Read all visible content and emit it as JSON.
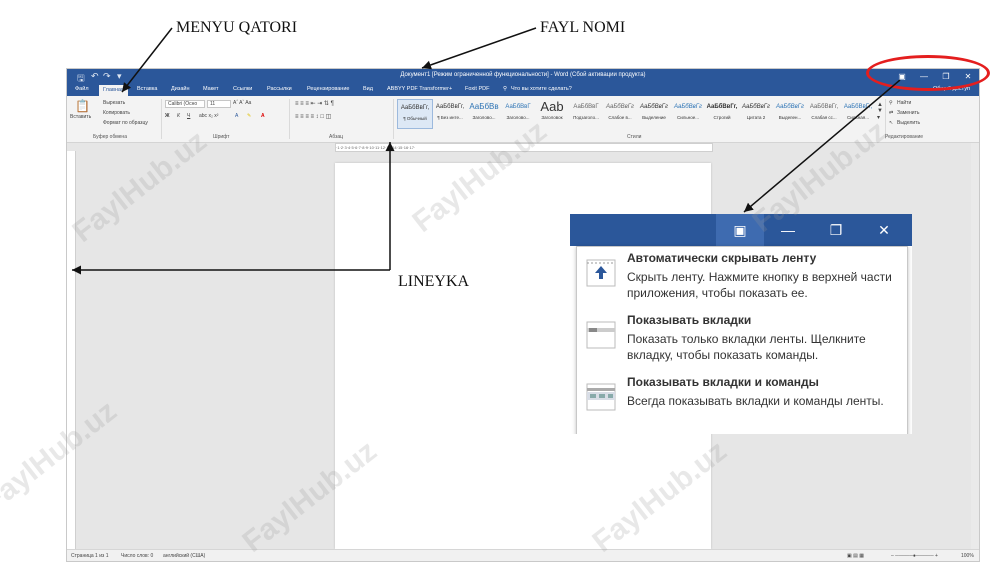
{
  "annotations": {
    "menu_row": "MENYU QATORI",
    "file_name": "FAYL NOMI",
    "ruler": "LINEYKA"
  },
  "watermark": "FaylHub.uz",
  "window": {
    "title": "Документ1 [Режим ограниченной функциональности] - Word (Сбой активации продукта)",
    "share_label": "Общий доступ",
    "tabs": [
      "Файл",
      "Главная",
      "Вставка",
      "Дизайн",
      "Макет",
      "Ссылки",
      "Рассылки",
      "Рецензирование",
      "Вид",
      "ABBYY PDF Transformer+",
      "Foxit PDF"
    ],
    "tell_me": "Что вы хотите сделать?"
  },
  "ribbon": {
    "clipboard": {
      "paste": "Вставить",
      "cut": "Вырезать",
      "copy": "Копировать",
      "format_painter": "Формат по образцу",
      "group": "Буфер обмена"
    },
    "font": {
      "name": "Calibri (Осно",
      "size": "11",
      "group": "Шрифт"
    },
    "paragraph": {
      "group": "Абзац"
    },
    "styles": {
      "group": "Стили",
      "items": [
        {
          "sample": "АаБбВвГг,",
          "name": "¶ Обычный"
        },
        {
          "sample": "АаБбВвГг,",
          "name": "¶ Без инте..."
        },
        {
          "sample": "АаБбВв",
          "name": "Заголово..."
        },
        {
          "sample": "АаБбВвГ",
          "name": "Заголово..."
        },
        {
          "sample": "Aab",
          "name": "Заголовок"
        },
        {
          "sample": "АаБбВвГ",
          "name": "Подзаголо..."
        },
        {
          "sample": "АаБбВвГг",
          "name": "Слабое в..."
        },
        {
          "sample": "АаБбВвГг",
          "name": "Выделение"
        },
        {
          "sample": "АаБбВвГг",
          "name": "Сильное..."
        },
        {
          "sample": "АаБбВвГг,",
          "name": "Строгий"
        },
        {
          "sample": "АаБбВвГг",
          "name": "Цитата 2"
        },
        {
          "sample": "АаБбВвГг",
          "name": "Выделен..."
        },
        {
          "sample": "АаБбВвГг,",
          "name": "Слабая сс..."
        },
        {
          "sample": "АаБбВвГг,",
          "name": "Сильная..."
        }
      ]
    },
    "editing": {
      "find": "Найти",
      "replace": "Заменить",
      "select": "Выделить",
      "group": "Редактирование"
    }
  },
  "statusbar": {
    "page": "Страница 1 из 1",
    "words": "Число слов: 0",
    "language": "английский (США)",
    "zoom": "100%"
  },
  "popup": {
    "options": [
      {
        "title": "Автоматически скрывать ленту",
        "desc": "Скрыть ленту. Нажмите кнопку в верхней части приложения, чтобы показать ее.",
        "icon": "auto-hide-ribbon-icon"
      },
      {
        "title": "Показывать вкладки",
        "desc": "Показать только вкладки ленты. Щелкните вкладку, чтобы показать команды.",
        "icon": "show-tabs-icon"
      },
      {
        "title": "Показывать вкладки и команды",
        "desc": "Всегда показывать вкладки и команды ленты.",
        "icon": "show-tabs-commands-icon"
      }
    ]
  },
  "colors": {
    "word_blue": "#2b579a",
    "highlight_red": "#e41e1e"
  }
}
